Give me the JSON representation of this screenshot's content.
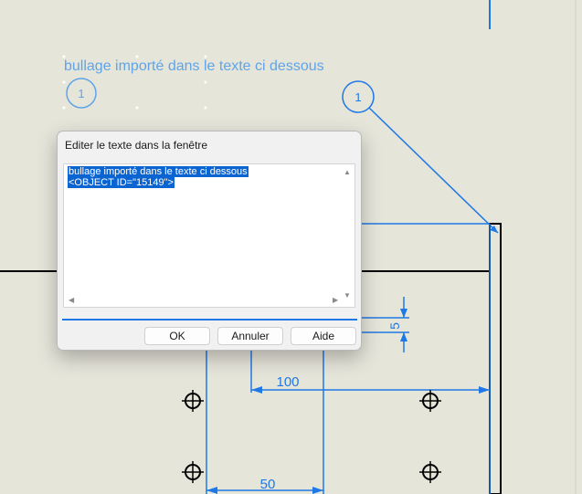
{
  "note": {
    "text": "bullage importé dans le texte ci dessous",
    "balloon_small": "1",
    "balloon_large": "1"
  },
  "dimensions": {
    "d100": "100",
    "d50": "50",
    "d5": "5"
  },
  "dialog": {
    "title": "Editer le texte dans la fenêtre",
    "lines": [
      "bullage importé dans le texte ci dessous",
      "<OBJECT ID=\"15149\">"
    ],
    "ok_label": "OK",
    "cancel_label": "Annuler",
    "help_label": "Aide"
  },
  "colors": {
    "background": "#e6e5da",
    "dimension_blue": "#1e78e6",
    "note_blue": "#5fa4e8",
    "selection": "#0a64d2"
  }
}
